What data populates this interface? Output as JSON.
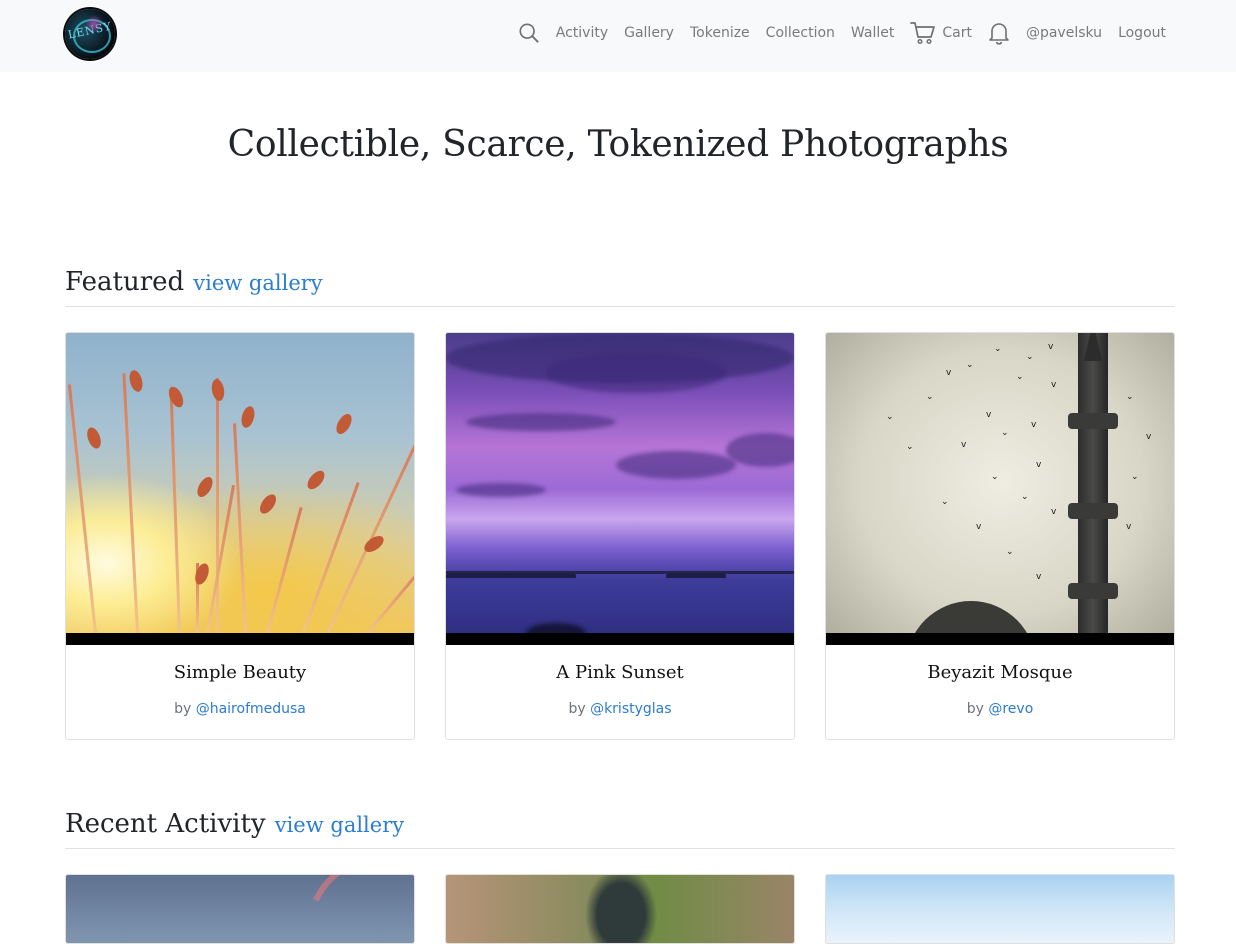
{
  "nav": {
    "logo_text": "LENSY",
    "items": [
      "Activity",
      "Gallery",
      "Tokenize",
      "Collection",
      "Wallet"
    ],
    "cart_label": "Cart",
    "user_label": "@pavelsku",
    "logout_label": "Logout"
  },
  "hero": {
    "title": "Collectible, Scarce, Tokenized Photographs"
  },
  "featured": {
    "title": "Featured",
    "link": "view gallery",
    "cards": [
      {
        "title": "Simple Beauty",
        "by": "by",
        "author": "@hairofmedusa"
      },
      {
        "title": "A Pink Sunset",
        "by": "by",
        "author": "@kristyglas"
      },
      {
        "title": "Beyazit Mosque",
        "by": "by",
        "author": "@revo"
      }
    ]
  },
  "recent": {
    "title": "Recent Activity",
    "link": "view gallery"
  },
  "colors": {
    "navbar_bg": "#f8f9fa",
    "link": "#2b7cd3",
    "nav_text": "#7a7a7a"
  }
}
